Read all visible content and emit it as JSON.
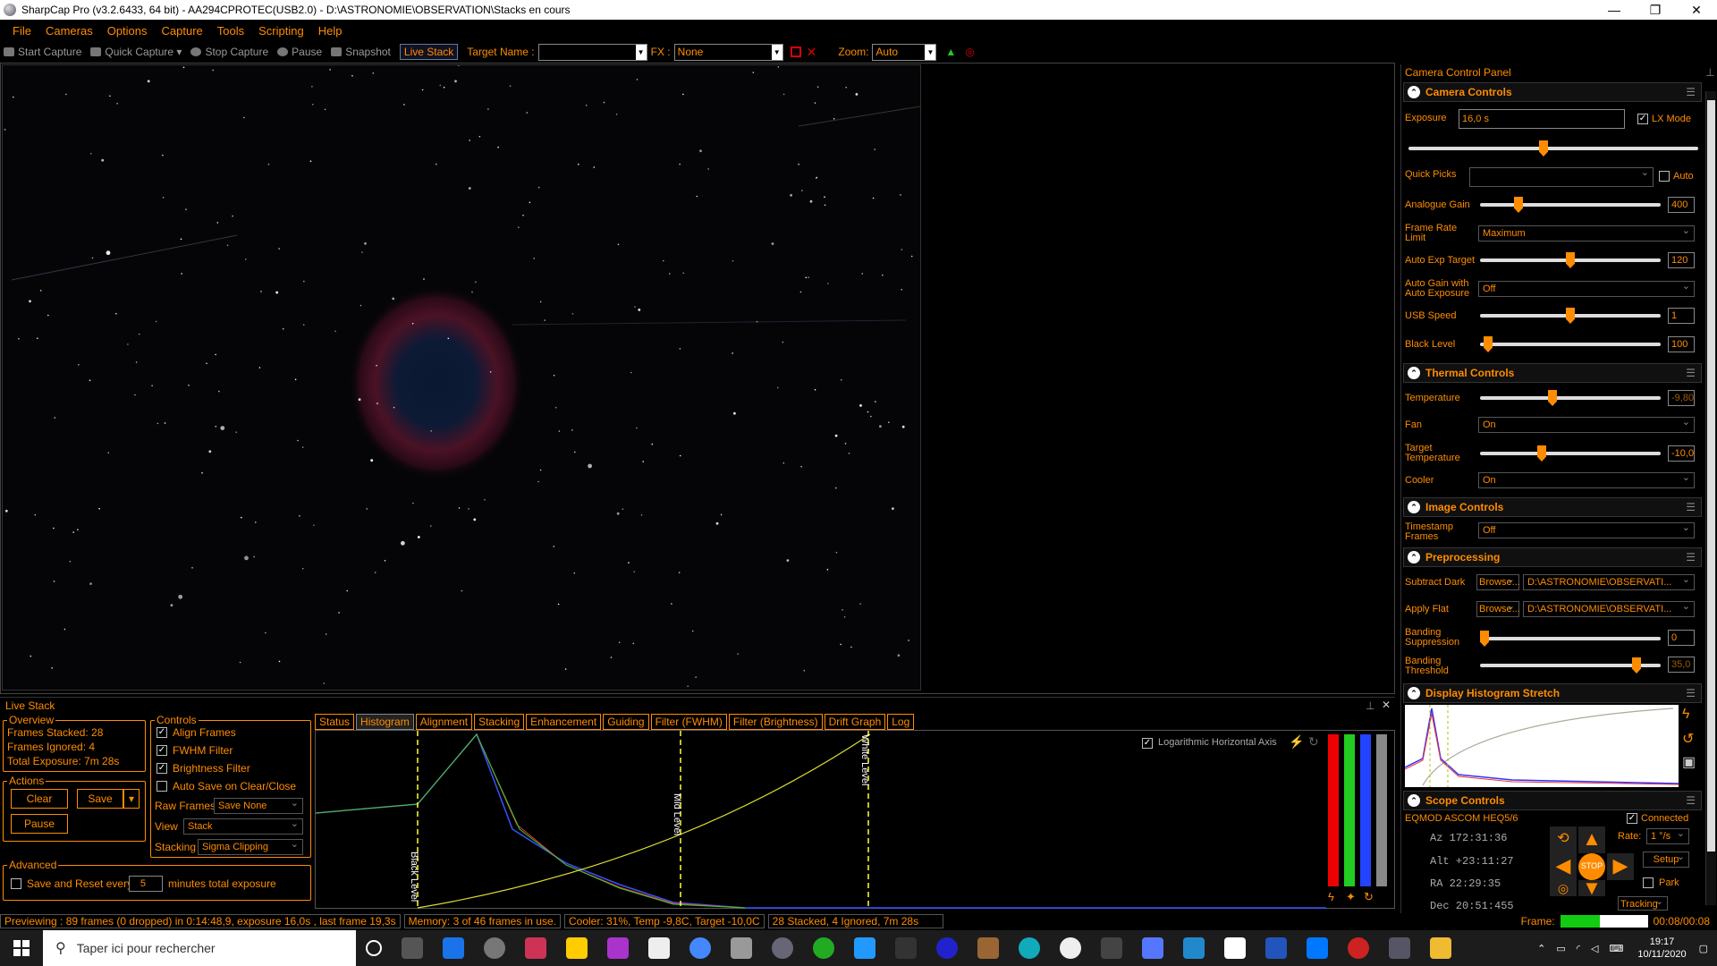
{
  "window": {
    "title": "SharpCap Pro (v3.2.6433, 64 bit) - AA294CPROTEC(USB2.0) - D:\\ASTRONOMIE\\OBSERVATION\\Stacks en cours",
    "minimize": "—",
    "maximize": "❐",
    "close": "✕"
  },
  "menu": [
    "File",
    "Cameras",
    "Options",
    "Capture",
    "Tools",
    "Scripting",
    "Help"
  ],
  "toolbar": {
    "start_capture": "Start Capture",
    "quick_capture": "Quick Capture",
    "stop_capture": "Stop Capture",
    "pause": "Pause",
    "snapshot": "Snapshot",
    "live_stack": "Live Stack",
    "target_name_label": "Target Name :",
    "target_name_value": "",
    "fx_label": "FX :",
    "fx_value": "None",
    "zoom_label": "Zoom:",
    "zoom_value": "Auto"
  },
  "live_stack": {
    "title": "Live Stack",
    "overview": {
      "title": "Overview",
      "frames_stacked": "Frames Stacked: 28",
      "frames_ignored": "Frames Ignored:  4",
      "total_exposure": "Total Exposure:   7m 28s"
    },
    "actions": {
      "title": "Actions",
      "clear": "Clear",
      "save": "Save",
      "pause": "Pause"
    },
    "advanced": {
      "title": "Advanced",
      "save_reset": "Save and Reset every",
      "minutes_value": "5",
      "minutes_suffix": "minutes total exposure"
    },
    "controls": {
      "title": "Controls",
      "align_frames": "Align Frames",
      "fwhm_filter": "FWHM Filter",
      "brightness_filter": "Brightness Filter",
      "auto_save": "Auto Save on Clear/Close",
      "raw_frames_label": "Raw Frames",
      "raw_frames_value": "Save None",
      "view_label": "View",
      "view_value": "Stack",
      "stacking_label": "Stacking",
      "stacking_value": "Sigma Clipping"
    },
    "tabs": [
      "Status",
      "Histogram",
      "Alignment",
      "Stacking",
      "Enhancement",
      "Guiding",
      "Filter (FWHM)",
      "Filter (Brightness)",
      "Drift Graph",
      "Log"
    ],
    "active_tab": "Histogram",
    "histogram": {
      "log_axis": "Logarithmic Horizontal Axis",
      "black_level": "Black Level",
      "mid_level": "Mid Level",
      "white_level": "White Level"
    }
  },
  "status": {
    "previewing": "Previewing : 89 frames (0 dropped) in 0:14:48,9, exposure 16,0s , last frame 19,3s",
    "memory": "Memory: 3 of 46 frames in use.",
    "cooler": "Cooler: 31%, Temp -9,8C, Target -10,0C",
    "stacked": "28 Stacked, 4 Ignored, 7m 28s",
    "frame_label": "Frame:",
    "frame_time": "00:08/00:08"
  },
  "panel": {
    "title": "Camera Control Panel",
    "camera_controls": {
      "title": "Camera Controls",
      "exposure_label": "Exposure",
      "exposure_value": "16,0 s",
      "lx_mode": "LX Mode",
      "quick_picks": "Quick Picks",
      "auto": "Auto",
      "analogue_gain_label": "Analogue Gain",
      "analogue_gain_value": "400",
      "frame_rate_label": "Frame Rate Limit",
      "frame_rate_value": "Maximum",
      "auto_exp_label": "Auto Exp Target",
      "auto_exp_value": "120",
      "auto_gain_label": "Auto Gain with Auto Exposure",
      "auto_gain_value": "Off",
      "usb_label": "USB Speed",
      "usb_value": "1",
      "black_label": "Black Level",
      "black_value": "100"
    },
    "thermal": {
      "title": "Thermal Controls",
      "temp_label": "Temperature",
      "temp_value": "-9,80",
      "fan_label": "Fan",
      "fan_value": "On",
      "target_label": "Target Temperature",
      "target_value": "-10,0",
      "cooler_label": "Cooler",
      "cooler_value": "On"
    },
    "image": {
      "title": "Image Controls",
      "timestamp_label": "Timestamp Frames",
      "timestamp_value": "Off"
    },
    "preprocessing": {
      "title": "Preprocessing",
      "dark_label": "Subtract Dark",
      "flat_label": "Apply Flat",
      "browse": "Browse...",
      "path": "D:\\ASTRONOMIE\\OBSERVATI...",
      "banding_label": "Banding Suppression",
      "banding_value": "0",
      "threshold_label": "Banding Threshold",
      "threshold_value": "35,0"
    },
    "histogram_stretch": {
      "title": "Display Histogram Stretch"
    },
    "scope": {
      "title": "Scope Controls",
      "mount": "EQMOD ASCOM HEQ5/6",
      "connected": "Connected",
      "az": "Az  172:31:36",
      "alt": "Alt +23:11:27",
      "ra": "RA  22:29:35",
      "dec": "Dec 20:51:455",
      "rate_label": "Rate:",
      "rate_value": "1 °/s",
      "setup": "Setup",
      "park": "Park",
      "stop": "STOP",
      "tracking": "Tracking"
    }
  },
  "taskbar": {
    "search_placeholder": "Taper ici pour rechercher",
    "time": "19:17",
    "date": "10/11/2020"
  },
  "colors": {
    "accent": "#ff8c00",
    "background": "#000000"
  }
}
